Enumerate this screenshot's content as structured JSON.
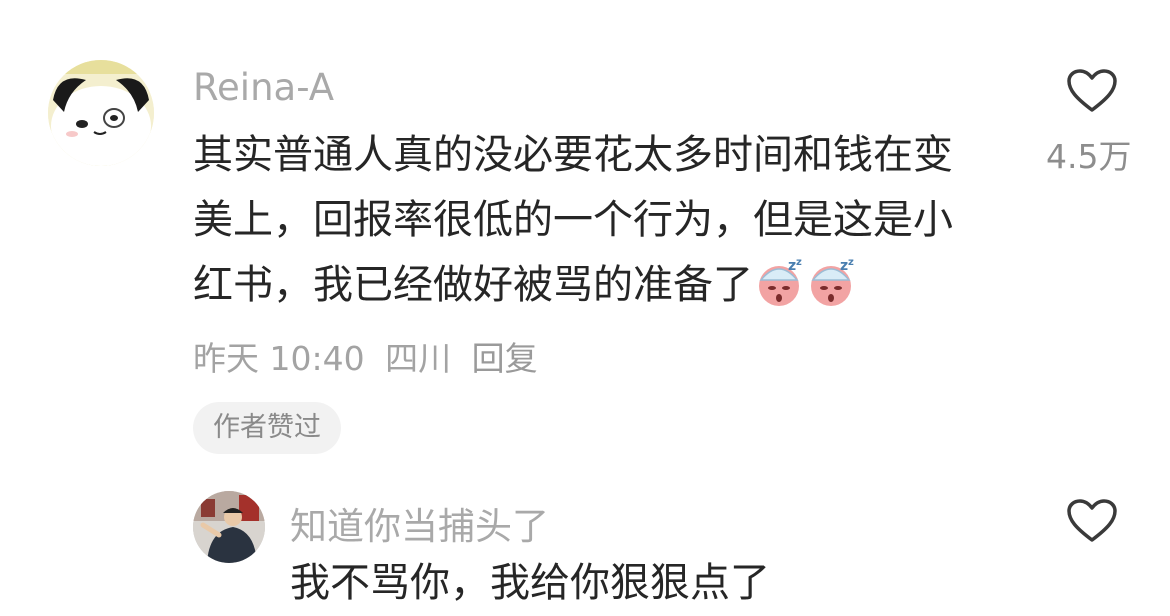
{
  "comment": {
    "username": "Reina-A",
    "text_lines": [
      "其实普通人真的没必要花太多时间和钱在变",
      "美上，回报率很低的一个行为，但是这是小",
      "红书，我已经做好被骂的准备了"
    ],
    "emojis": [
      "sleepy-face-icon",
      "sleepy-face-icon"
    ],
    "time": "昨天 10:40",
    "location": "四川",
    "reply_label": "回复",
    "author_liked_badge": "作者赞过",
    "like_count": "4.5万"
  },
  "reply": {
    "username": "知道你当捕头了",
    "text": "我不骂你，我给你狠狠点了"
  },
  "colors": {
    "text": "#262626",
    "muted": "#a9a9a9",
    "badge_bg": "#f2f2f2"
  }
}
